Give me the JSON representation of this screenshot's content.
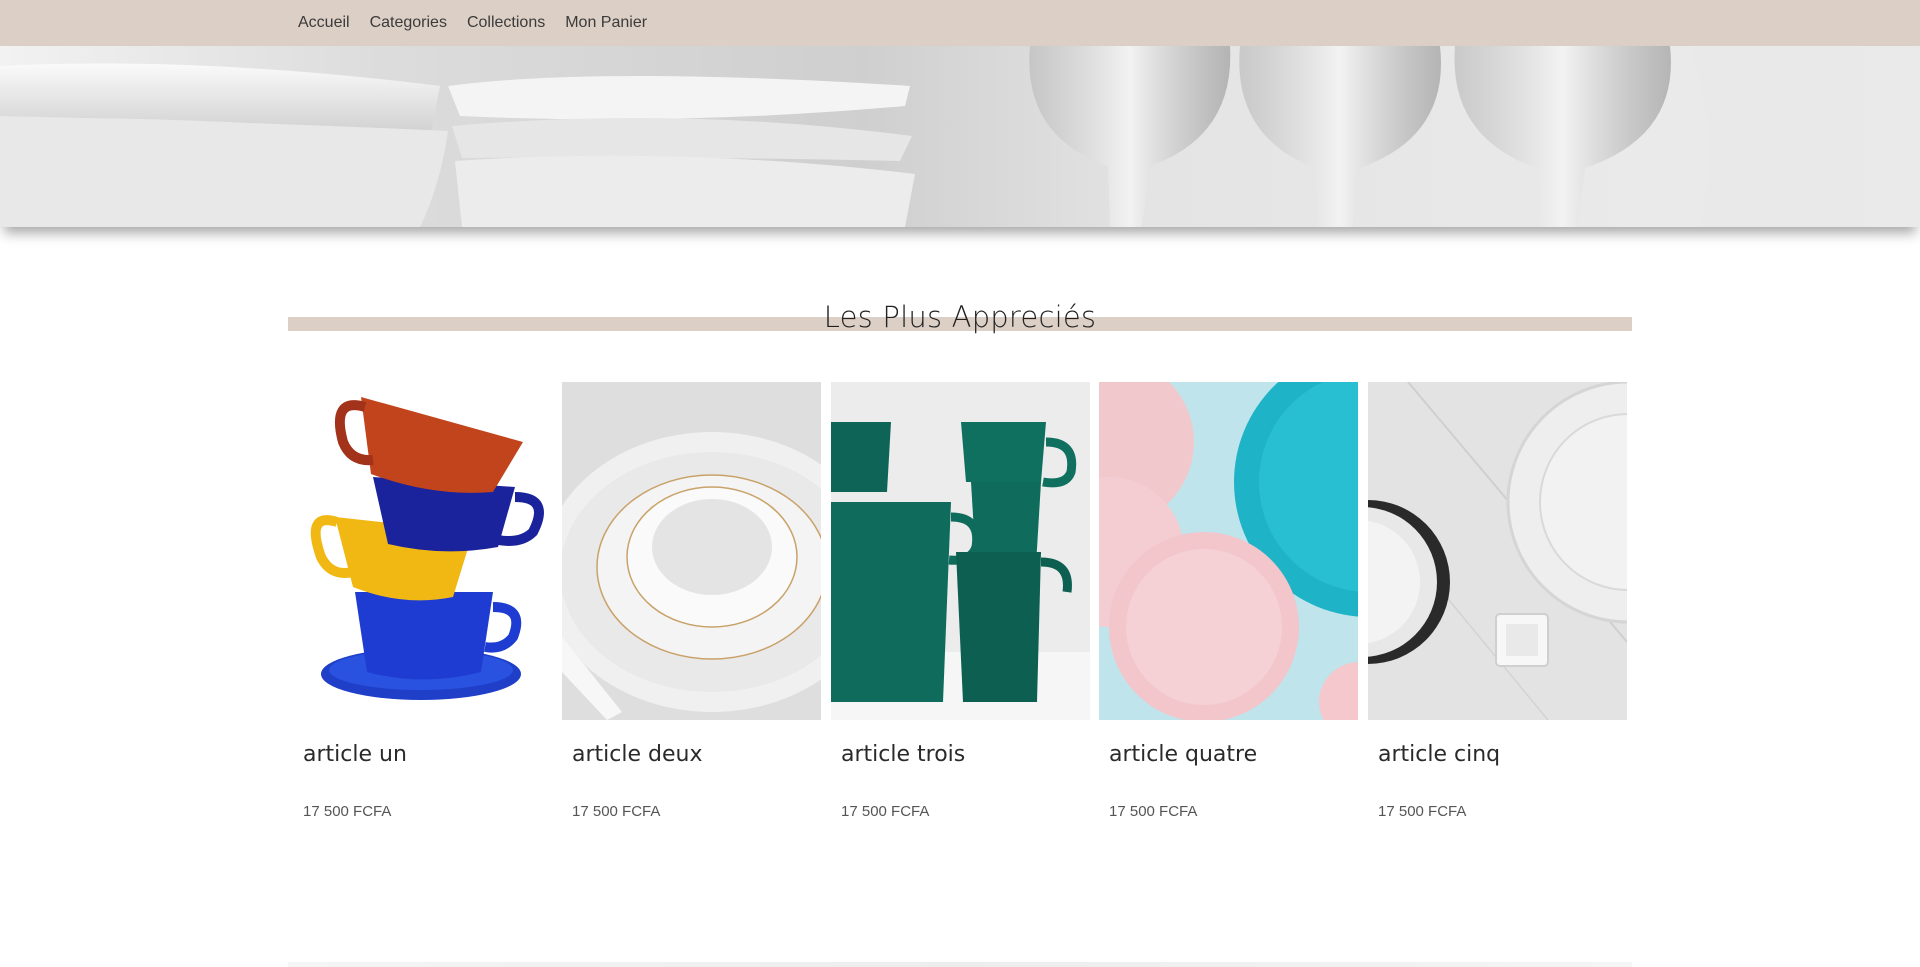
{
  "nav": {
    "items": [
      {
        "label": "Accueil"
      },
      {
        "label": "Categories"
      },
      {
        "label": "Collections"
      },
      {
        "label": "Mon Panier"
      }
    ]
  },
  "section": {
    "title": "Les Plus Appreciés"
  },
  "products": [
    {
      "name": "article un",
      "price": "17 500 FCFA",
      "image": "colorful-stacked-teacups"
    },
    {
      "name": "article deux",
      "price": "17 500 FCFA",
      "image": "white-porcelain-bowl-set"
    },
    {
      "name": "article trois",
      "price": "17 500 FCFA",
      "image": "green-stacked-mugs"
    },
    {
      "name": "article quatre",
      "price": "17 500 FCFA",
      "image": "pink-and-turquoise-plates"
    },
    {
      "name": "article cinq",
      "price": "17 500 FCFA",
      "image": "grey-plates-on-marble"
    }
  ],
  "colors": {
    "nav_background": "#dccfc6",
    "accent_bar": "#dccfc6",
    "text": "#2a2a2a"
  }
}
